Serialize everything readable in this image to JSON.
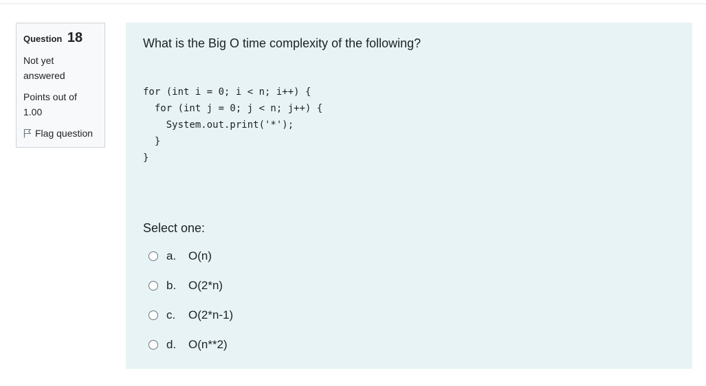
{
  "question": {
    "label": "Question",
    "number": "18",
    "state_line1": "Not yet",
    "state_line2": "answered",
    "grade_line1": "Points out of",
    "grade_line2": "1.00",
    "flag_label": "Flag question",
    "flag_icon": "flag-icon"
  },
  "content": {
    "question_text": "What is the Big O time complexity of the following?",
    "code_lines": [
      "for (int i = 0; i < n; i++) {",
      "  for (int j = 0; j < n; j++) {",
      "    System.out.print('*');",
      "  }",
      "}"
    ],
    "select_label": "Select one:",
    "answers": [
      {
        "letter": "a.",
        "text": "O(n)"
      },
      {
        "letter": "b.",
        "text": "O(2*n)"
      },
      {
        "letter": "c.",
        "text": "O(2*n-1)"
      },
      {
        "letter": "d.",
        "text": "O(n**2)"
      }
    ]
  },
  "colors": {
    "content_bg": "#e7f3f5",
    "info_bg": "#f8f9fa",
    "border": "#cfd4d9"
  }
}
